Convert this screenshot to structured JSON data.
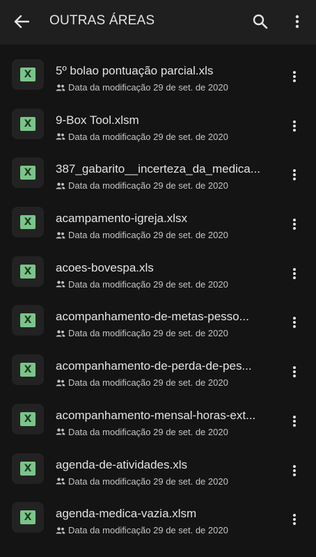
{
  "appbar": {
    "title": "OUTRAS ÁREAS",
    "back_icon": "arrow-back-icon",
    "search_icon": "search-icon",
    "more_icon": "more-vert-icon"
  },
  "colors": {
    "background": "#141414",
    "appbar": "#1f1f1f",
    "excel_badge": "#7bc48a",
    "text_primary": "#e3e3e3",
    "text_secondary": "#c4c4c4"
  },
  "files": [
    {
      "name": "5º bolao pontuação parcial.xls",
      "meta": "Data da modificação 29 de set. de 2020",
      "type_label": "X"
    },
    {
      "name": "9-Box Tool.xlsm",
      "meta": "Data da modificação 29 de set. de 2020",
      "type_label": "X"
    },
    {
      "name": "387_gabarito__incerteza_da_medica...",
      "meta": "Data da modificação 29 de set. de 2020",
      "type_label": "X"
    },
    {
      "name": "acampamento-igreja.xlsx",
      "meta": "Data da modificação 29 de set. de 2020",
      "type_label": "X"
    },
    {
      "name": "acoes-bovespa.xls",
      "meta": "Data da modificação 29 de set. de 2020",
      "type_label": "X"
    },
    {
      "name": "acompanhamento-de-metas-pesso...",
      "meta": "Data da modificação 29 de set. de 2020",
      "type_label": "X"
    },
    {
      "name": "acompanhamento-de-perda-de-pes...",
      "meta": "Data da modificação 29 de set. de 2020",
      "type_label": "X"
    },
    {
      "name": "acompanhamento-mensal-horas-ext...",
      "meta": "Data da modificação 29 de set. de 2020",
      "type_label": "X"
    },
    {
      "name": "agenda-de-atividades.xls",
      "meta": "Data da modificação 29 de set. de 2020",
      "type_label": "X"
    },
    {
      "name": "agenda-medica-vazia.xlsm",
      "meta": "Data da modificação 29 de set. de 2020",
      "type_label": "X"
    }
  ]
}
